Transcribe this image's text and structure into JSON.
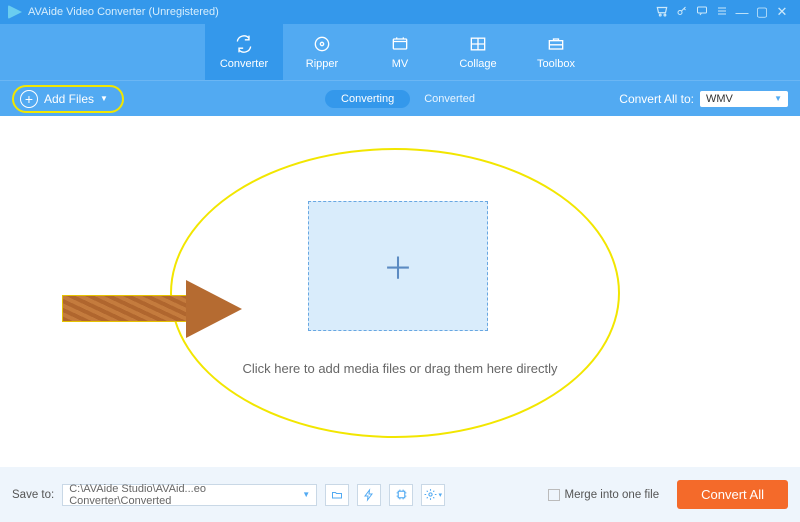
{
  "title": "AVAide Video Converter (Unregistered)",
  "win_icons": {
    "cart": "cart-icon",
    "key": "key-icon",
    "feedback": "speech-icon",
    "menu": "menu-icon",
    "min": "minimize-icon",
    "max": "maximize-icon",
    "close": "close-icon"
  },
  "nav": {
    "items": [
      {
        "label": "Converter",
        "icon": "convert-icon",
        "active": true
      },
      {
        "label": "Ripper",
        "icon": "ripper-icon",
        "active": false
      },
      {
        "label": "MV",
        "icon": "mv-icon",
        "active": false
      },
      {
        "label": "Collage",
        "icon": "collage-icon",
        "active": false
      },
      {
        "label": "Toolbox",
        "icon": "toolbox-icon",
        "active": false
      }
    ]
  },
  "subbar": {
    "add_files": "Add Files",
    "tab_converting": "Converting",
    "tab_converted": "Converted",
    "convert_all_to": "Convert All to:",
    "format": "WMV"
  },
  "workspace": {
    "drop_caption": "Click here to add media files or drag them here directly"
  },
  "footer": {
    "save_to_label": "Save to:",
    "save_path": "C:\\AVAide Studio\\AVAid...eo Converter\\Converted",
    "merge_label": "Merge into one file",
    "convert_all": "Convert All"
  }
}
